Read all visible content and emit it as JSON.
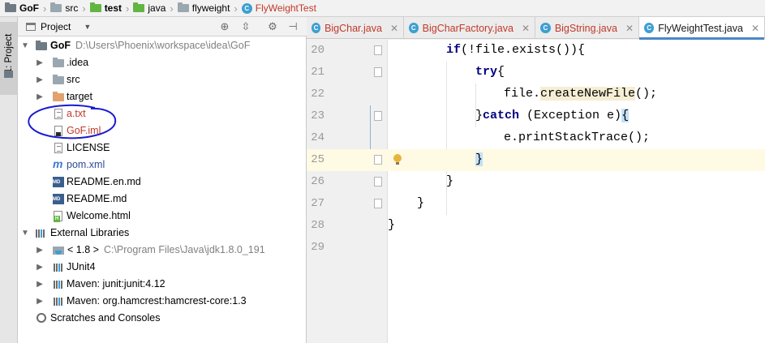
{
  "breadcrumb": [
    {
      "label": "GoF",
      "icon": "folder-icon",
      "style": "bold"
    },
    {
      "label": "src",
      "icon": "folder-icon",
      "style": "normal"
    },
    {
      "label": "test",
      "icon": "folder-icon",
      "style": "bold"
    },
    {
      "label": "java",
      "icon": "folder-icon",
      "style": "normal"
    },
    {
      "label": "flyweight",
      "icon": "folder-icon",
      "style": "normal"
    },
    {
      "label": "FlyWeightTest",
      "icon": "class-icon",
      "style": "red"
    }
  ],
  "side_tab": {
    "label": "1: Project"
  },
  "project_panel": {
    "title": "Project",
    "tree": [
      {
        "label": "GoF",
        "hint": "D:\\Users\\Phoenix\\workspace\\idea\\GoF",
        "depth": 0,
        "expanded": true,
        "icon": "folder-icon"
      },
      {
        "label": ".idea",
        "depth": 1,
        "expanded": false,
        "icon": "folder-icon"
      },
      {
        "label": "src",
        "depth": 1,
        "expanded": false,
        "icon": "folder-icon"
      },
      {
        "label": "target",
        "depth": 1,
        "expanded": false,
        "icon": "folder-icon"
      },
      {
        "label": "a.txt",
        "depth": 1,
        "icon": "text-file-icon"
      },
      {
        "label": "GoF.iml",
        "depth": 1,
        "icon": "iml-file-icon"
      },
      {
        "label": "LICENSE",
        "depth": 1,
        "icon": "text-file-icon"
      },
      {
        "label": "pom.xml",
        "depth": 1,
        "icon": "maven-icon"
      },
      {
        "label": "README.en.md",
        "depth": 1,
        "icon": "markdown-icon"
      },
      {
        "label": "README.md",
        "depth": 1,
        "icon": "markdown-icon"
      },
      {
        "label": "Welcome.html",
        "depth": 1,
        "icon": "html-icon"
      },
      {
        "label": "External Libraries",
        "depth": 0,
        "expanded": true,
        "icon": "library-icon"
      },
      {
        "label": "< 1.8 >",
        "hint": "C:\\Program Files\\Java\\jdk1.8.0_191",
        "depth": 1,
        "expanded": false,
        "icon": "jdk-icon"
      },
      {
        "label": "JUnit4",
        "depth": 1,
        "expanded": false,
        "icon": "library-icon"
      },
      {
        "label": "Maven: junit:junit:4.12",
        "depth": 1,
        "expanded": false,
        "icon": "library-icon"
      },
      {
        "label": "Maven: org.hamcrest:hamcrest-core:1.3",
        "depth": 1,
        "expanded": false,
        "icon": "library-icon"
      },
      {
        "label": "Scratches and Consoles",
        "depth": 0,
        "icon": "scratches-icon"
      }
    ]
  },
  "editor": {
    "tabs": [
      {
        "label": "BigChar.java",
        "active": false
      },
      {
        "label": "BigCharFactory.java",
        "active": false
      },
      {
        "label": "BigString.java",
        "active": false
      },
      {
        "label": "FlyWeightTest.java",
        "active": true
      }
    ],
    "lines": [
      {
        "num": "20",
        "text": "if(!file.exists()){"
      },
      {
        "num": "21",
        "text": "try{"
      },
      {
        "num": "22",
        "text": "file.createNewFile();"
      },
      {
        "num": "23",
        "text": "}catch (Exception e){"
      },
      {
        "num": "24",
        "text": "e.printStackTrace();"
      },
      {
        "num": "25",
        "text": "}"
      },
      {
        "num": "26",
        "text": "}"
      },
      {
        "num": "27",
        "text": "}"
      },
      {
        "num": "28",
        "text": "}"
      },
      {
        "num": "29",
        "text": ""
      }
    ]
  },
  "colors": {
    "keyword": "#000080",
    "error_red": "#c0392b",
    "accent": "#4a88c7",
    "annotation_circle": "#1a1ad0"
  }
}
